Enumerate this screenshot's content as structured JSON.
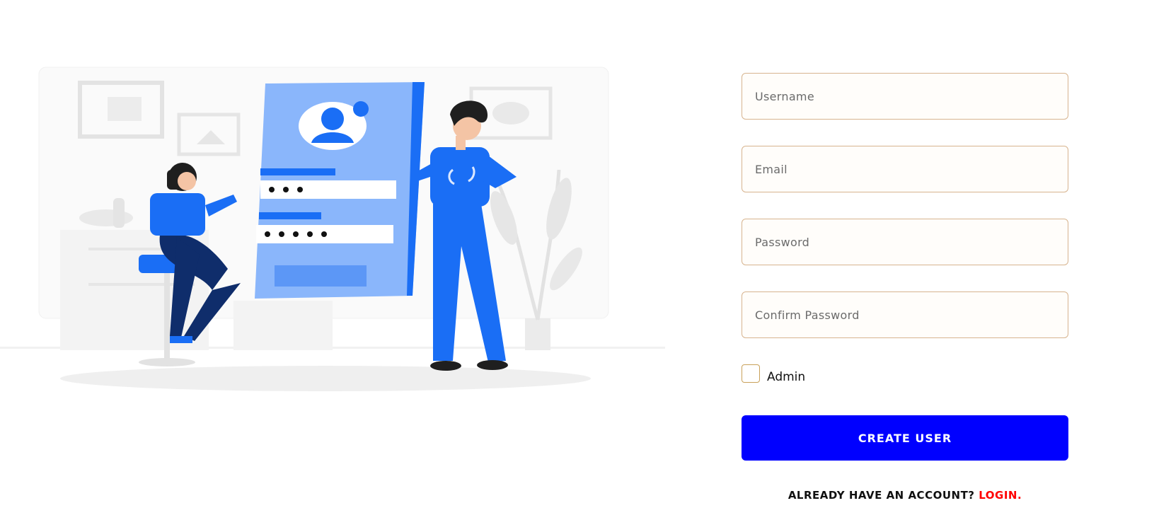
{
  "form": {
    "username_placeholder": "Username",
    "email_placeholder": "Email",
    "password_placeholder": "Password",
    "confirm_password_placeholder": "Confirm Password",
    "admin_label": "Admin",
    "admin_checked": false,
    "create_button_label": "CREATE USER"
  },
  "footer": {
    "prompt_text": "ALREADY HAVE AN ACCOUNT?",
    "login_link_text": "LOGIN."
  },
  "illustration": {
    "icon": "signup-illustration"
  },
  "colors": {
    "accent_blue": "#0000ff",
    "link_red": "#ff0000",
    "field_border": "#d7b48f",
    "illustration_blue": "#1a6ef5"
  }
}
